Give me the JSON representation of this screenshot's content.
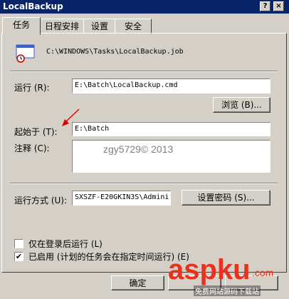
{
  "window": {
    "title": "LocalBackup",
    "help_label": "?",
    "close_label": "×"
  },
  "tabs": [
    {
      "label": "任务"
    },
    {
      "label": "日程安排"
    },
    {
      "label": "设置"
    },
    {
      "label": "安全"
    }
  ],
  "task": {
    "path": "C:\\WINDOWS\\Tasks\\LocalBackup.job",
    "run_label": "运行 (R):",
    "run_value": "E:\\Batch\\LocalBackup.cmd",
    "browse_label": "浏览 (B)...",
    "start_in_label": "起始于 (T):",
    "start_in_value": "E:\\Batch",
    "comment_label": "注释 (C):",
    "comment_value": "",
    "run_as_label": "运行方式 (U):",
    "run_as_value": "SXSZF-E20GKIN3S\\Admini:",
    "set_password_label": "设置密码 (S)..."
  },
  "options": {
    "logged_on_only_label": "仅在登录后运行 (L)",
    "logged_on_only_checked": false,
    "enabled_label": "已启用 (计划的任务会在指定时间运行) (E)",
    "enabled_checked": true
  },
  "footer": {
    "ok_label": "确定"
  },
  "watermarks": {
    "copyright": "zgy5729© 2013",
    "brand": "aspku",
    "brand_tld": ".com",
    "brand_sub": "免费网站源码下载站"
  }
}
